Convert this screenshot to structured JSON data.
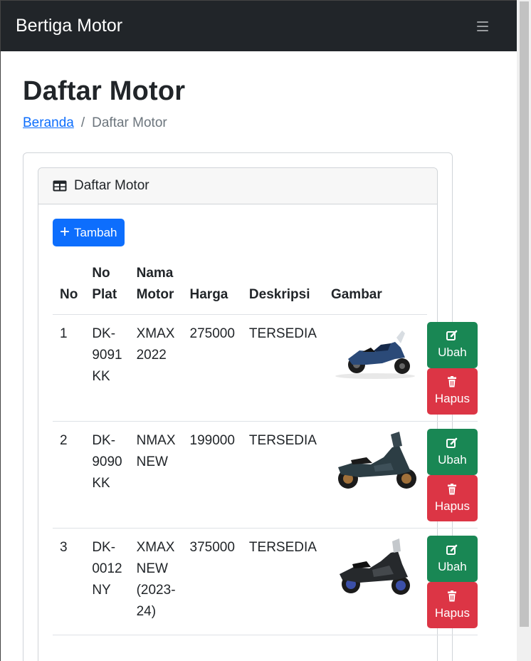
{
  "brand": "Bertiga Motor",
  "page_title": "Daftar Motor",
  "breadcrumb": {
    "home": "Beranda",
    "separator": "/",
    "current": "Daftar Motor"
  },
  "card": {
    "title": "Daftar Motor",
    "add_label": "Tambah"
  },
  "table": {
    "headers": {
      "no": "No",
      "plat": "No Plat",
      "nama": "Nama Motor",
      "harga": "Harga",
      "deskripsi": "Deskripsi",
      "gambar": "Gambar"
    },
    "rows": [
      {
        "no": "1",
        "plat": "DK-9091 KK",
        "nama": "XMAX 2022",
        "harga": "275000",
        "deskripsi": "TERSEDIA"
      },
      {
        "no": "2",
        "plat": "DK-9090 KK",
        "nama": "NMAX NEW",
        "harga": "199000",
        "deskripsi": "TERSEDIA"
      },
      {
        "no": "3",
        "plat": "DK-0012 NY",
        "nama": "XMAX NEW (2023-24)",
        "harga": "375000",
        "deskripsi": "TERSEDIA"
      }
    ],
    "edit_label": "Ubah",
    "delete_label": "Hapus"
  },
  "colors": {
    "navbar": "#212529",
    "primary": "#0d6efd",
    "success": "#198754",
    "danger": "#dc3545"
  }
}
